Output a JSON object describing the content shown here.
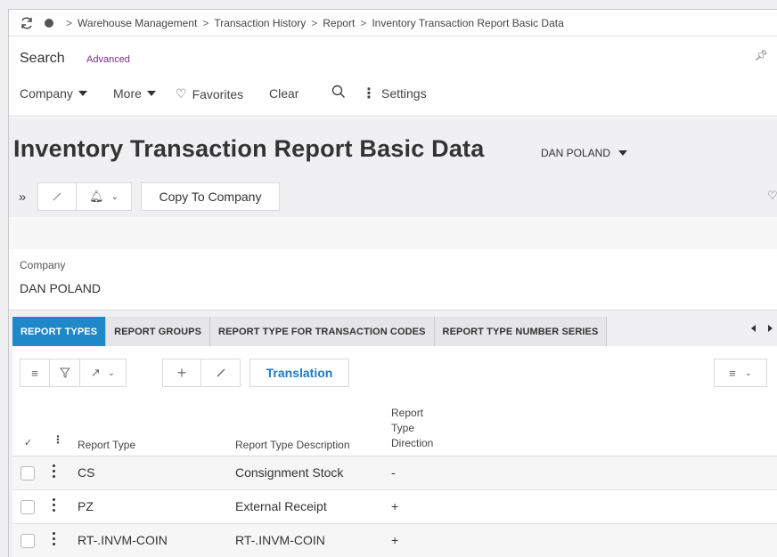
{
  "breadcrumb": {
    "items": [
      "Warehouse Management",
      "Transaction History",
      "Report",
      "Inventory Transaction Report Basic Data"
    ]
  },
  "search": {
    "title": "Search",
    "advanced_label": "Advanced",
    "pin_icon": "pin-icon",
    "bar": {
      "company_label": "Company",
      "more_label": "More",
      "favorites_label": "Favorites",
      "clear_label": "Clear",
      "settings_label": "Settings"
    }
  },
  "page": {
    "title": "Inventory Transaction Report Basic Data",
    "company_selector": "DAN POLAND",
    "copy_to_company_label": "Copy To Company"
  },
  "header_form": {
    "company_label": "Company",
    "company_value": "DAN POLAND"
  },
  "tabs": [
    {
      "label": "REPORT TYPES",
      "active": true
    },
    {
      "label": "REPORT GROUPS",
      "active": false
    },
    {
      "label": "REPORT TYPE FOR TRANSACTION CODES",
      "active": false
    },
    {
      "label": "REPORT TYPE NUMBER SERIES",
      "active": false
    }
  ],
  "grid": {
    "translation_label": "Translation",
    "columns": [
      "Report Type",
      "Report Type Description",
      "Report Type Direction"
    ],
    "column_direction_lines": [
      "Report",
      "Type",
      "Direction"
    ],
    "rows": [
      {
        "report_type": "CS",
        "description": "Consignment Stock",
        "direction": "-"
      },
      {
        "report_type": "PZ",
        "description": "External Receipt",
        "direction": "+"
      },
      {
        "report_type": "RT-.INVM-COIN",
        "description": "RT-.INVM-COIN",
        "direction": "+"
      }
    ]
  },
  "colors": {
    "active_tab": "#1e88c8",
    "link_blue": "#1f7ac0",
    "advanced_purple": "#7a2c8f",
    "page_bg": "#f0f0f2"
  }
}
